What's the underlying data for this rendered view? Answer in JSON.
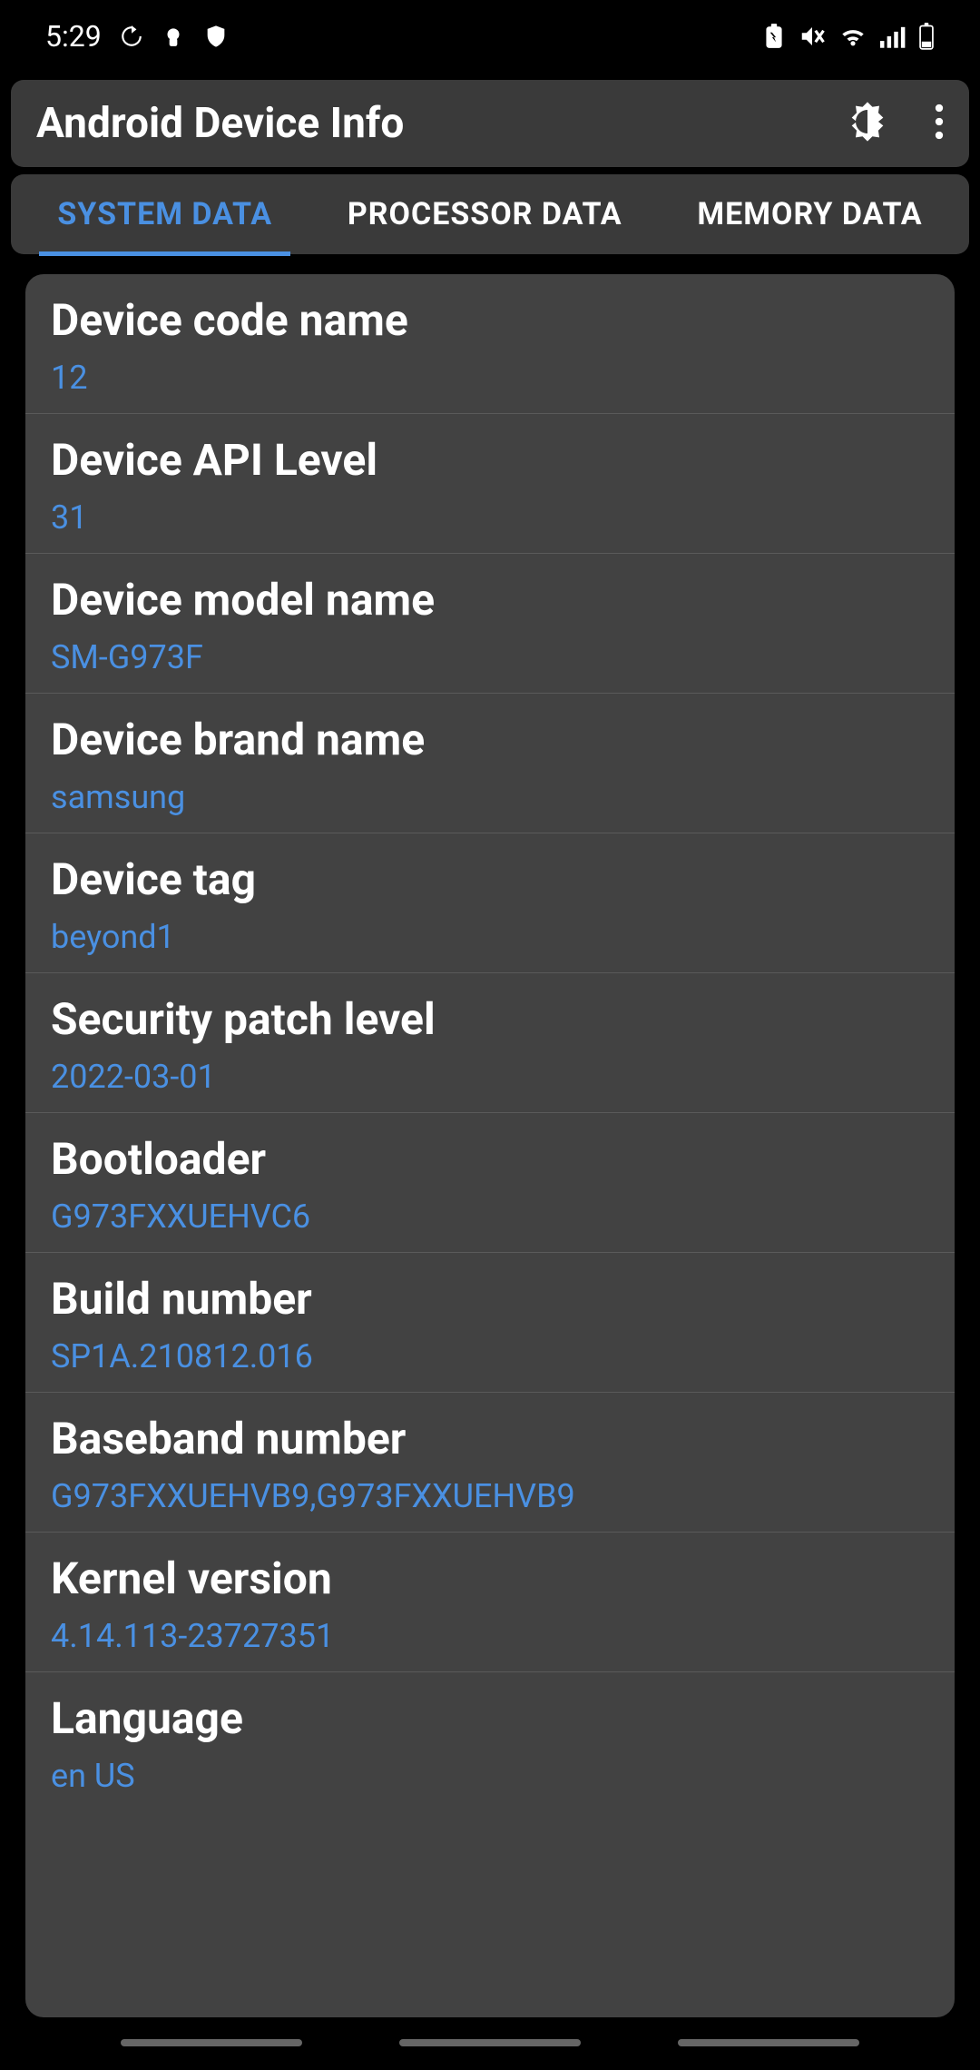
{
  "status": {
    "time": "5:29"
  },
  "header": {
    "title": "Android Device Info"
  },
  "tabs": [
    {
      "label": "SYSTEM DATA",
      "active": true
    },
    {
      "label": "PROCESSOR DATA",
      "active": false
    },
    {
      "label": "MEMORY DATA",
      "active": false
    }
  ],
  "items": [
    {
      "label": "Device code name",
      "value": "12"
    },
    {
      "label": "Device API Level",
      "value": "31"
    },
    {
      "label": "Device model name",
      "value": "SM-G973F"
    },
    {
      "label": "Device brand name",
      "value": "samsung"
    },
    {
      "label": "Device tag",
      "value": "beyond1"
    },
    {
      "label": "Security patch level",
      "value": "2022-03-01"
    },
    {
      "label": "Bootloader",
      "value": "G973FXXUEHVC6"
    },
    {
      "label": "Build number",
      "value": "SP1A.210812.016"
    },
    {
      "label": "Baseband number",
      "value": "G973FXXUEHVB9,G973FXXUEHVB9"
    },
    {
      "label": "Kernel version",
      "value": "4.14.113-23727351"
    },
    {
      "label": "Language",
      "value": "en US"
    }
  ]
}
